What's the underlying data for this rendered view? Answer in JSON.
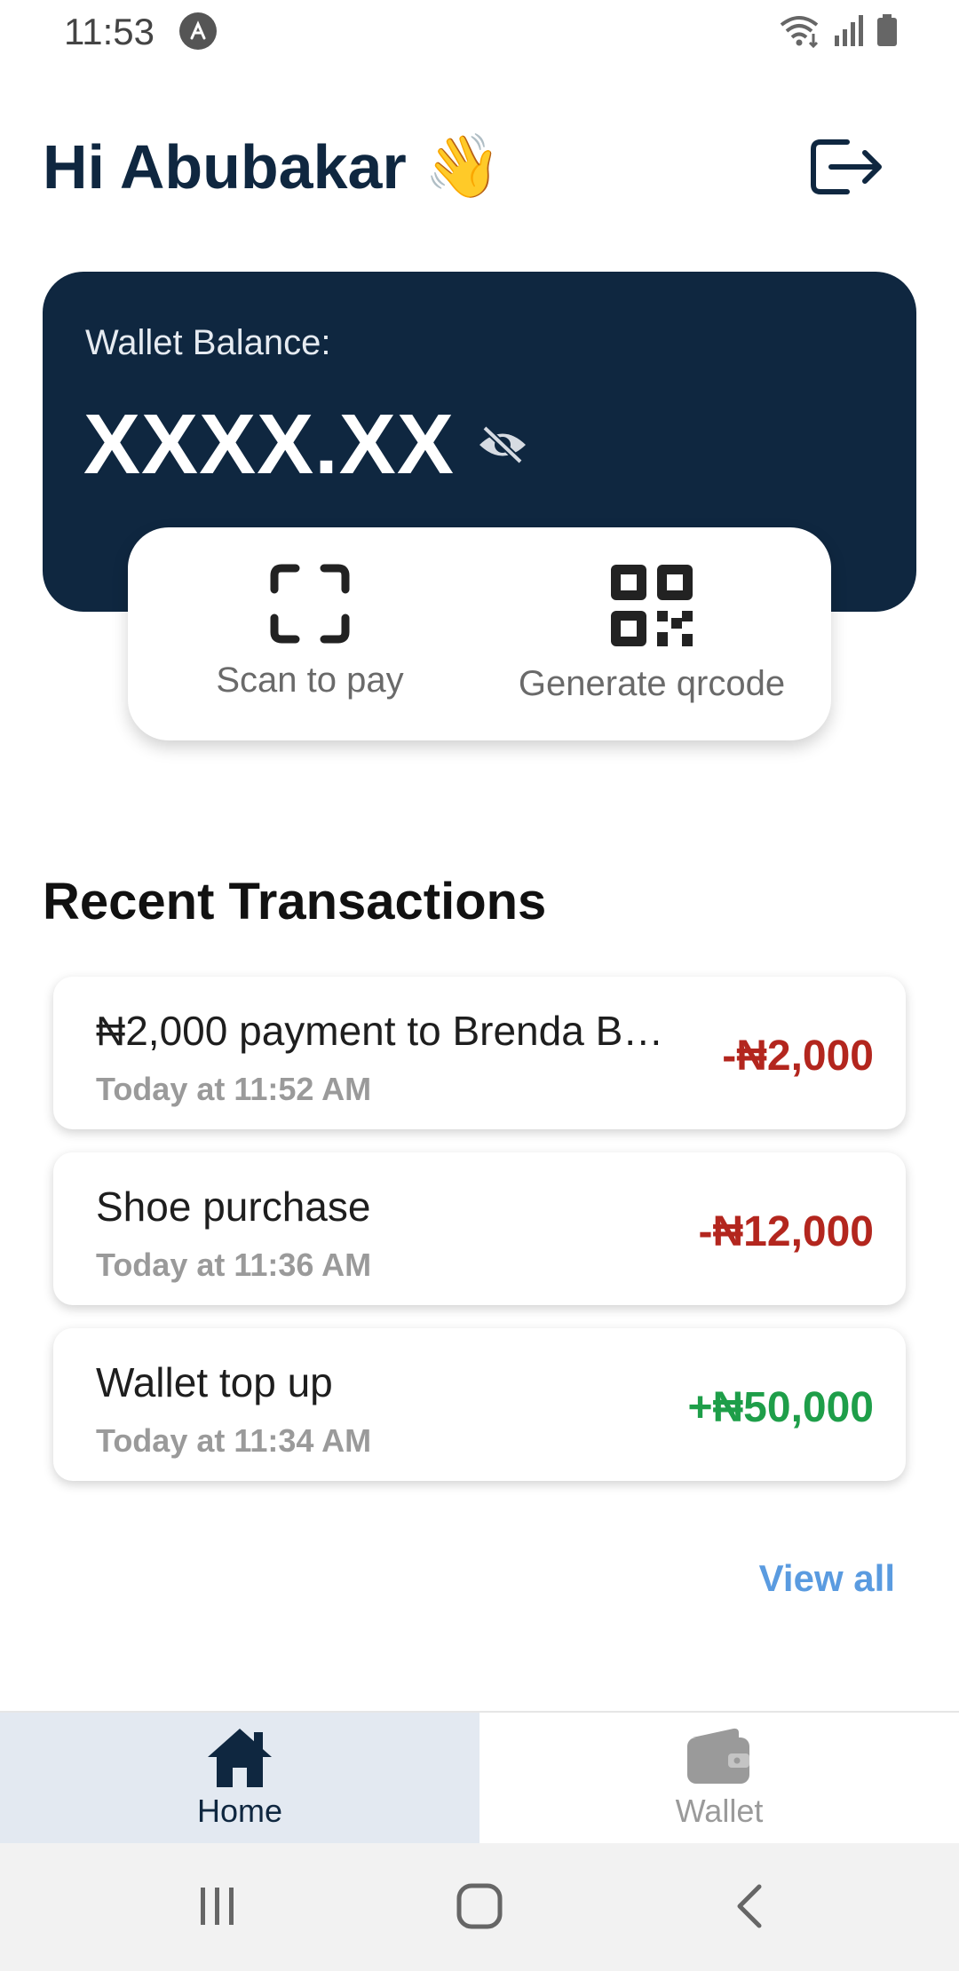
{
  "status_bar": {
    "time": "11:53"
  },
  "header": {
    "greeting": "Hi Abubakar",
    "wave_emoji": "👋"
  },
  "wallet": {
    "label": "Wallet Balance:",
    "amount": "XXXX.XX"
  },
  "actions": {
    "scan_label": "Scan to pay",
    "generate_label": "Generate qrcode"
  },
  "transactions": {
    "title": "Recent Transactions",
    "items": [
      {
        "title": "₦2,000 payment to Brenda B…",
        "time": "Today at 11:52 AM",
        "amount": "-₦2,000",
        "type": "debit"
      },
      {
        "title": "Shoe purchase",
        "time": "Today at 11:36 AM",
        "amount": "-₦12,000",
        "type": "debit"
      },
      {
        "title": "Wallet top up",
        "time": "Today at 11:34 AM",
        "amount": "+₦50,000",
        "type": "credit"
      }
    ],
    "view_all_label": "View all"
  },
  "bottom_nav": {
    "items": [
      {
        "label": "Home",
        "icon": "home-icon",
        "active": true
      },
      {
        "label": "Wallet",
        "icon": "wallet-icon",
        "active": false
      }
    ]
  },
  "colors": {
    "primary": "#0f2740",
    "debit": "#b3261e",
    "credit": "#1e9e49",
    "link": "#5a9be0",
    "nav_active_bg": "#e3e9f1"
  }
}
